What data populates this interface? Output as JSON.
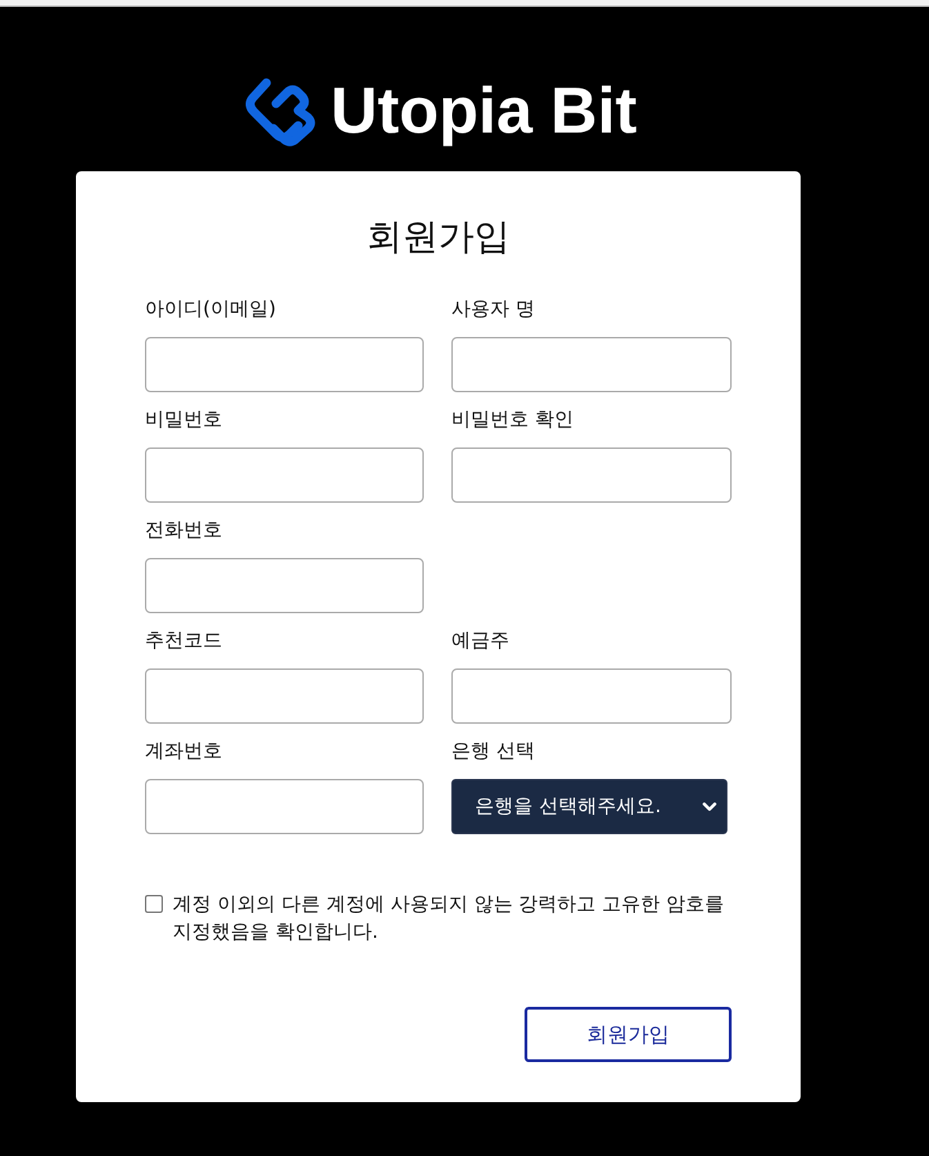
{
  "logo": {
    "text": "Utopia Bit"
  },
  "form": {
    "title": "회원가입",
    "rows": [
      {
        "fields": [
          {
            "kind": "input",
            "label": "아이디(이메일)"
          },
          {
            "kind": "input",
            "label": "사용자 명"
          }
        ]
      },
      {
        "fields": [
          {
            "kind": "input",
            "label": "비밀번호"
          },
          {
            "kind": "input",
            "label": "비밀번호 확인"
          }
        ]
      },
      {
        "fields": [
          {
            "kind": "input",
            "label": "전화번호"
          }
        ]
      },
      {
        "fields": [
          {
            "kind": "input",
            "label": "추천코드"
          },
          {
            "kind": "input",
            "label": "예금주"
          }
        ]
      },
      {
        "fields": [
          {
            "kind": "input",
            "label": "계좌번호"
          },
          {
            "kind": "select",
            "label": "은행 선택",
            "value": "은행을 선택해주세요."
          }
        ]
      }
    ],
    "agreement": {
      "checked": false,
      "text": "계정 이외의 다른 계정에 사용되지 않는 강력하고 고유한 암호를 지정했음을 확인합니다."
    },
    "submit_button": {
      "label": "회원가입"
    }
  }
}
